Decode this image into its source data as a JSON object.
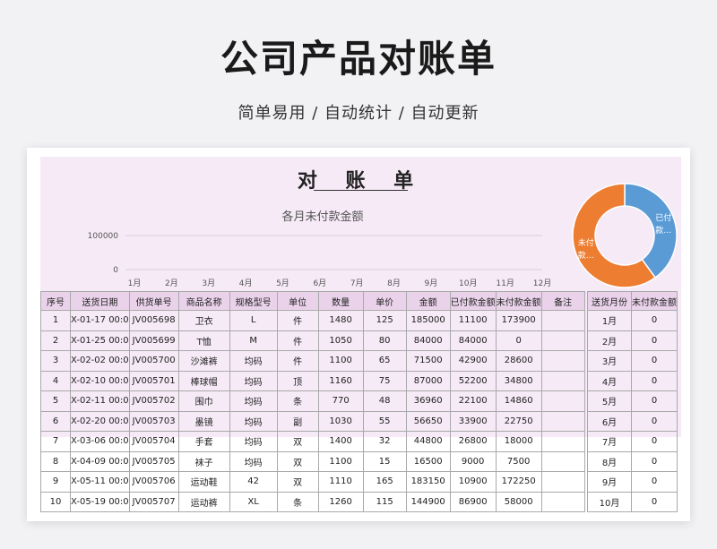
{
  "page": {
    "title": "公司产品对账单",
    "subtitle": "简单易用 / 自动统计 / 自动更新"
  },
  "sheet": {
    "title": "对 账 单",
    "chart_title": "各月未付款金额",
    "y_ticks": [
      "100000",
      "0"
    ],
    "months": [
      "1月",
      "2月",
      "3月",
      "4月",
      "5月",
      "6月",
      "7月",
      "8月",
      "9月",
      "10月",
      "11月",
      "12月"
    ],
    "donut_labels": {
      "paid": "已付款…",
      "unpaid": "未付款…"
    }
  },
  "colors": {
    "paid": "#5b9bd5",
    "unpaid": "#ed7d31",
    "header_bg": "#f6eaf6",
    "table_header": "#ead3ea"
  },
  "chart_data": [
    {
      "type": "line",
      "title": "各月未付款金额",
      "categories": [
        "1月",
        "2月",
        "3月",
        "4月",
        "5月",
        "6月",
        "7月",
        "8月",
        "9月",
        "10月",
        "11月",
        "12月"
      ],
      "values": [
        0,
        0,
        0,
        0,
        0,
        0,
        0,
        0,
        0,
        0,
        0,
        0
      ],
      "ylim": [
        0,
        100000
      ],
      "grid": true
    },
    {
      "type": "pie",
      "labels": [
        "已付款…",
        "未付款…"
      ],
      "values": [
        0.4,
        0.6
      ]
    }
  ],
  "table": {
    "headers": [
      "序号",
      "送货日期",
      "供货单号",
      "商品名称",
      "规格型号",
      "单位",
      "数量",
      "单价",
      "金额",
      "已付款金额",
      "未付款金额",
      "备注"
    ],
    "rows": [
      [
        "1",
        "X-01-17 00:0",
        "JV005698",
        "卫衣",
        "L",
        "件",
        "1480",
        "125",
        "185000",
        "11100",
        "173900",
        ""
      ],
      [
        "2",
        "X-01-25 00:0",
        "JV005699",
        "T恤",
        "M",
        "件",
        "1050",
        "80",
        "84000",
        "84000",
        "0",
        ""
      ],
      [
        "3",
        "X-02-02 00:0",
        "JV005700",
        "沙滩裤",
        "均码",
        "件",
        "1100",
        "65",
        "71500",
        "42900",
        "28600",
        ""
      ],
      [
        "4",
        "X-02-10 00:0",
        "JV005701",
        "棒球帽",
        "均码",
        "顶",
        "1160",
        "75",
        "87000",
        "52200",
        "34800",
        ""
      ],
      [
        "5",
        "X-02-11 00:0",
        "JV005702",
        "围巾",
        "均码",
        "条",
        "770",
        "48",
        "36960",
        "22100",
        "14860",
        ""
      ],
      [
        "6",
        "X-02-20 00:0",
        "JV005703",
        "墨镜",
        "均码",
        "副",
        "1030",
        "55",
        "56650",
        "33900",
        "22750",
        ""
      ],
      [
        "7",
        "X-03-06 00:0",
        "JV005704",
        "手套",
        "均码",
        "双",
        "1400",
        "32",
        "44800",
        "26800",
        "18000",
        ""
      ],
      [
        "8",
        "X-04-09 00:0",
        "JV005705",
        "袜子",
        "均码",
        "双",
        "1100",
        "15",
        "16500",
        "9000",
        "7500",
        ""
      ],
      [
        "9",
        "X-05-11 00:0",
        "JV005706",
        "运动鞋",
        "42",
        "双",
        "1110",
        "165",
        "183150",
        "10900",
        "172250",
        ""
      ],
      [
        "10",
        "X-05-19 00:0",
        "JV005707",
        "运动裤",
        "XL",
        "条",
        "1260",
        "115",
        "144900",
        "86900",
        "58000",
        ""
      ]
    ]
  },
  "side_table": {
    "headers": [
      "送货月份",
      "未付款金额"
    ],
    "rows": [
      [
        "1月",
        "0"
      ],
      [
        "2月",
        "0"
      ],
      [
        "3月",
        "0"
      ],
      [
        "4月",
        "0"
      ],
      [
        "5月",
        "0"
      ],
      [
        "6月",
        "0"
      ],
      [
        "7月",
        "0"
      ],
      [
        "8月",
        "0"
      ],
      [
        "9月",
        "0"
      ],
      [
        "10月",
        "0"
      ]
    ]
  }
}
